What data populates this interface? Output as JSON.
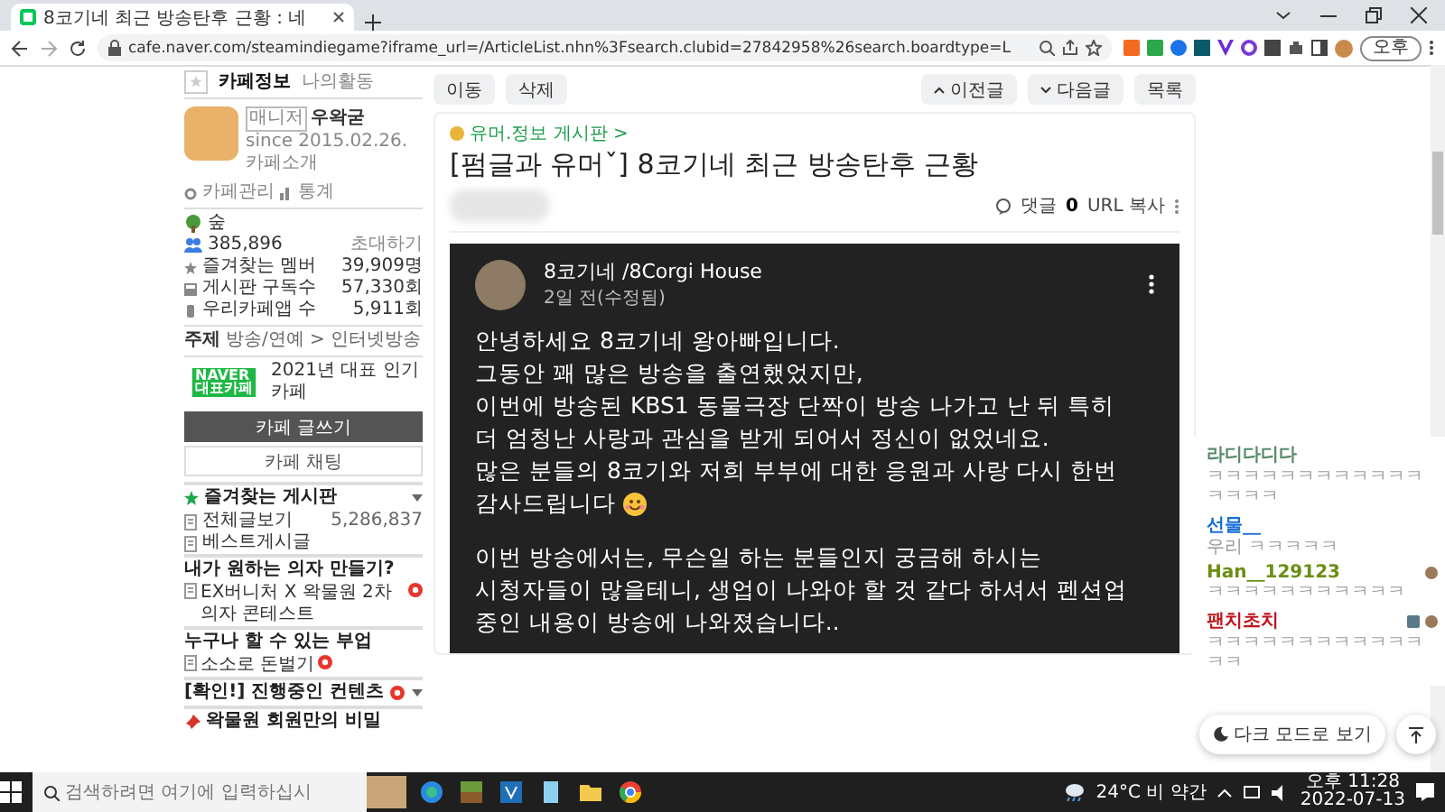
{
  "browser": {
    "tab_title": "8코기네 최근 방송탄후 근황 : 네",
    "url": "cafe.naver.com/steamindiegame?iframe_url=/ArticleList.nhn%3Fsearch.clubid=27842958%26search.boardtype=L",
    "profile_label": "오후"
  },
  "sidebar": {
    "tabs": [
      {
        "label": "카페정보",
        "selected": true
      },
      {
        "label": "나의활동",
        "selected": false
      }
    ],
    "manager_badge": "매니저",
    "manager": "우왁굳",
    "since": "since 2015.02.26.",
    "intro_link": "카페소개",
    "admin_link": "카페관리",
    "stats_link": "통계",
    "level": "숲",
    "members": "385,896",
    "invite": "초대하기",
    "stats": [
      {
        "label": "즐겨찾는 멤버",
        "value": "39,909명"
      },
      {
        "label": "게시판 구독수",
        "value": "57,330회"
      },
      {
        "label": "우리카페앱 수",
        "value": "5,911회"
      }
    ],
    "topic_label": "주제",
    "topic": "방송/연예 > 인터넷방송",
    "award_badge": [
      "NAVER",
      "대표카페"
    ],
    "award": "2021년 대표 인기카페",
    "buttons": [
      "카페 글쓰기",
      "카페 채팅"
    ],
    "favorites": "즐겨찾는 게시판",
    "boards": [
      {
        "label": "전체글보기",
        "count": "5,286,837"
      },
      {
        "label": "베스트게시글"
      }
    ],
    "sections": [
      {
        "title": "내가 원하는 의자 만들기?",
        "items": [
          {
            "label": "EX버니처 X 왁물원 2차 의자 콘테스트",
            "new": true
          }
        ]
      },
      {
        "title": "누구나 할 수 있는 부업",
        "items": [
          {
            "label": "소소로 돈벌기",
            "new": true
          }
        ]
      }
    ],
    "contents": {
      "label": "[확인!] 진행중인 컨텐츠",
      "new": true
    },
    "secret": "왁물원 회원만의 비밀"
  },
  "toolbar": {
    "left": [
      "이동",
      "삭제"
    ],
    "prev": "이전글",
    "next": "다음글",
    "list": "목록"
  },
  "article": {
    "board": "유머.정보 게시판 >",
    "title": "[펌글과 유머ˇ] 8코기네 최근 방송탄후 근황",
    "comment_label": "댓글",
    "comment_count": "0",
    "url_copy": "URL 복사",
    "post": {
      "author": "8코기네 /8Corgi House",
      "time": "2일 전(수정됨)",
      "paragraphs": [
        {
          "lines": [
            {
              "text": "안녕하세요 8코기네 왕아빠입니다."
            },
            {
              "text": "그동안 꽤 많은 방송을 출연했었지만,"
            },
            {
              "text": "이번에 방송된 KBS1 동물극장 단짝이 방송 나가고 난 뒤 특히"
            },
            {
              "text": "더 엄청난 사랑과 관심을 받게 되어서 정신이 없었네요."
            },
            {
              "text": "많은 분들의 8코기와 저희 부부에 대한 응원과 사랑 다시 한번"
            },
            {
              "text": "감사드립니다",
              "emoji": true
            }
          ]
        },
        {
          "lines": [
            {
              "text": "이번 방송에서는, 무슨일 하는 분들인지 궁금해 하시는"
            },
            {
              "text": "시청자들이 많을테니, 생업이 나와야 할 것 같다 하셔서 펜션업"
            },
            {
              "text": "중인 내용이 방송에 나와졌습니다.."
            }
          ]
        }
      ]
    }
  },
  "chat": {
    "messages": [
      {
        "name": "라디다디다",
        "color": "#5b8a6e",
        "text": "ㅋㅋㅋㅋㅋㅋㅋㅋㅋㅋㅋㅋㅋㅋㅋㅋ"
      },
      {
        "name": "선물__",
        "color": "#1a6fd6",
        "text": "우리 ㅋㅋㅋㅋㅋ"
      },
      {
        "name": "Han__129123",
        "color": "#6b8e12",
        "text": "ㅋㅋㅋㅋㅋㅋㅋㅋㅋㅋㅋ",
        "badges": [
          {
            "kind": "avatar"
          }
        ]
      },
      {
        "name": "팬치초치",
        "color": "#c0141a",
        "text": "ㅋㅋㅋㅋㅋㅋㅋㅋㅋㅋㅋㅋㅋㅋ",
        "badges": [
          {
            "kind": "emblem"
          },
          {
            "kind": "avatar"
          }
        ]
      }
    ],
    "dark_mode": "다크 모드로 보기"
  },
  "taskbar": {
    "search_placeholder": "검색하려면 여기에 입력하십시",
    "weather": "24°C 비 약간",
    "time": "오후 11:28",
    "date": "2022-07-13"
  }
}
